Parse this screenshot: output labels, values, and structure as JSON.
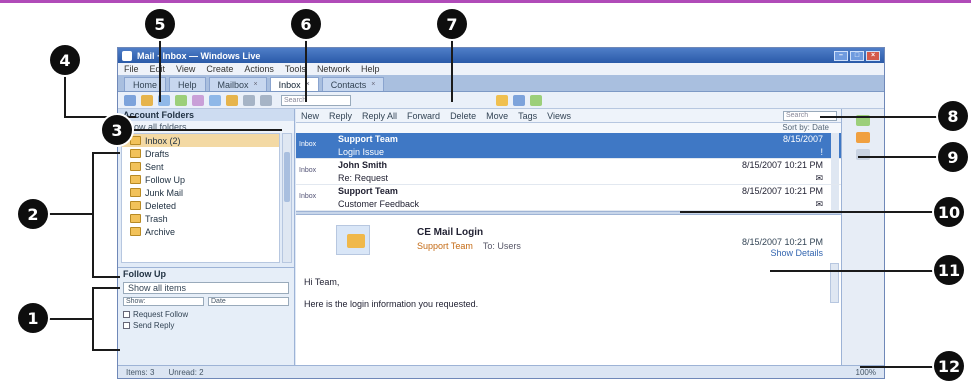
{
  "window": {
    "title": "Mail · Inbox — Windows Live",
    "menu": [
      "File",
      "Edit",
      "View",
      "Create",
      "Actions",
      "Tools",
      "Network",
      "Help"
    ]
  },
  "tabs": [
    {
      "label": "Home"
    },
    {
      "label": "Help"
    },
    {
      "label": "Mailbox"
    },
    {
      "label": "Inbox"
    },
    {
      "label": "Contacts"
    }
  ],
  "toolbar": {
    "search_placeholder": "Search"
  },
  "folders": {
    "title": "Account Folders",
    "subtitle": "Show all folders",
    "items": [
      {
        "label": "Inbox (2)",
        "selected": true
      },
      {
        "label": "Drafts"
      },
      {
        "label": "Sent"
      },
      {
        "label": "Follow Up"
      },
      {
        "label": "Junk Mail"
      },
      {
        "label": "Deleted"
      },
      {
        "label": "Trash"
      },
      {
        "label": "Archive"
      }
    ]
  },
  "follow_up": {
    "title": "Follow Up",
    "select": "Show all items",
    "filter_label": "Show:",
    "filter_value": "Date",
    "items": [
      "Request Follow",
      "Send Reply"
    ]
  },
  "viewbar": {
    "items": [
      "New",
      "Reply",
      "Reply All",
      "Forward",
      "Delete",
      "Move",
      "Tags",
      "Views"
    ],
    "search_placeholder": "Search"
  },
  "sort_label": "Sort by: Date",
  "messages": [
    {
      "label": "Inbox",
      "from": "Support Team",
      "date": "8/15/2007",
      "subject": "Login Issue",
      "icon": "!",
      "selected": true
    },
    {
      "label": "Inbox",
      "from": "John Smith",
      "date": "8/15/2007 10:21 PM",
      "subject": "Re: Request",
      "icon": "✉",
      "selected": false
    },
    {
      "label": "Inbox",
      "from": "Support Team",
      "date": "8/15/2007 10:21 PM",
      "subject": "Customer Feedback",
      "icon": "✉",
      "selected": false
    }
  ],
  "reading": {
    "from": "CE Mail Login",
    "subject": "Support Team",
    "to": "To: Users",
    "date": "8/15/2007 10:21 PM",
    "link": "Show Details",
    "greeting": "Hi Team,",
    "body": "Here is the login information you requested."
  },
  "status": {
    "left": "Items: 3",
    "mid": "Unread: 2",
    "zoom": "100%"
  },
  "callouts": [
    "1",
    "2",
    "3",
    "4",
    "5",
    "6",
    "7",
    "8",
    "9",
    "10",
    "11",
    "12"
  ],
  "colors": {
    "accent": "#3f78c5",
    "selection_folder": "#f3d9a4",
    "callout": "#0e0e0e"
  }
}
